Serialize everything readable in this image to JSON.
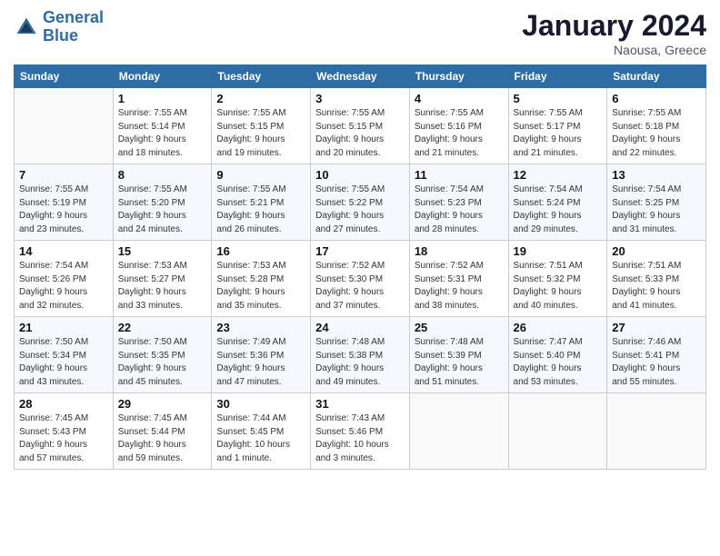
{
  "header": {
    "logo_line1": "General",
    "logo_line2": "Blue",
    "month": "January 2024",
    "location": "Naousa, Greece"
  },
  "days_of_week": [
    "Sunday",
    "Monday",
    "Tuesday",
    "Wednesday",
    "Thursday",
    "Friday",
    "Saturday"
  ],
  "weeks": [
    [
      {
        "day": "",
        "info": ""
      },
      {
        "day": "1",
        "info": "Sunrise: 7:55 AM\nSunset: 5:14 PM\nDaylight: 9 hours\nand 18 minutes."
      },
      {
        "day": "2",
        "info": "Sunrise: 7:55 AM\nSunset: 5:15 PM\nDaylight: 9 hours\nand 19 minutes."
      },
      {
        "day": "3",
        "info": "Sunrise: 7:55 AM\nSunset: 5:15 PM\nDaylight: 9 hours\nand 20 minutes."
      },
      {
        "day": "4",
        "info": "Sunrise: 7:55 AM\nSunset: 5:16 PM\nDaylight: 9 hours\nand 21 minutes."
      },
      {
        "day": "5",
        "info": "Sunrise: 7:55 AM\nSunset: 5:17 PM\nDaylight: 9 hours\nand 21 minutes."
      },
      {
        "day": "6",
        "info": "Sunrise: 7:55 AM\nSunset: 5:18 PM\nDaylight: 9 hours\nand 22 minutes."
      }
    ],
    [
      {
        "day": "7",
        "info": "Sunrise: 7:55 AM\nSunset: 5:19 PM\nDaylight: 9 hours\nand 23 minutes."
      },
      {
        "day": "8",
        "info": "Sunrise: 7:55 AM\nSunset: 5:20 PM\nDaylight: 9 hours\nand 24 minutes."
      },
      {
        "day": "9",
        "info": "Sunrise: 7:55 AM\nSunset: 5:21 PM\nDaylight: 9 hours\nand 26 minutes."
      },
      {
        "day": "10",
        "info": "Sunrise: 7:55 AM\nSunset: 5:22 PM\nDaylight: 9 hours\nand 27 minutes."
      },
      {
        "day": "11",
        "info": "Sunrise: 7:54 AM\nSunset: 5:23 PM\nDaylight: 9 hours\nand 28 minutes."
      },
      {
        "day": "12",
        "info": "Sunrise: 7:54 AM\nSunset: 5:24 PM\nDaylight: 9 hours\nand 29 minutes."
      },
      {
        "day": "13",
        "info": "Sunrise: 7:54 AM\nSunset: 5:25 PM\nDaylight: 9 hours\nand 31 minutes."
      }
    ],
    [
      {
        "day": "14",
        "info": "Sunrise: 7:54 AM\nSunset: 5:26 PM\nDaylight: 9 hours\nand 32 minutes."
      },
      {
        "day": "15",
        "info": "Sunrise: 7:53 AM\nSunset: 5:27 PM\nDaylight: 9 hours\nand 33 minutes."
      },
      {
        "day": "16",
        "info": "Sunrise: 7:53 AM\nSunset: 5:28 PM\nDaylight: 9 hours\nand 35 minutes."
      },
      {
        "day": "17",
        "info": "Sunrise: 7:52 AM\nSunset: 5:30 PM\nDaylight: 9 hours\nand 37 minutes."
      },
      {
        "day": "18",
        "info": "Sunrise: 7:52 AM\nSunset: 5:31 PM\nDaylight: 9 hours\nand 38 minutes."
      },
      {
        "day": "19",
        "info": "Sunrise: 7:51 AM\nSunset: 5:32 PM\nDaylight: 9 hours\nand 40 minutes."
      },
      {
        "day": "20",
        "info": "Sunrise: 7:51 AM\nSunset: 5:33 PM\nDaylight: 9 hours\nand 41 minutes."
      }
    ],
    [
      {
        "day": "21",
        "info": "Sunrise: 7:50 AM\nSunset: 5:34 PM\nDaylight: 9 hours\nand 43 minutes."
      },
      {
        "day": "22",
        "info": "Sunrise: 7:50 AM\nSunset: 5:35 PM\nDaylight: 9 hours\nand 45 minutes."
      },
      {
        "day": "23",
        "info": "Sunrise: 7:49 AM\nSunset: 5:36 PM\nDaylight: 9 hours\nand 47 minutes."
      },
      {
        "day": "24",
        "info": "Sunrise: 7:48 AM\nSunset: 5:38 PM\nDaylight: 9 hours\nand 49 minutes."
      },
      {
        "day": "25",
        "info": "Sunrise: 7:48 AM\nSunset: 5:39 PM\nDaylight: 9 hours\nand 51 minutes."
      },
      {
        "day": "26",
        "info": "Sunrise: 7:47 AM\nSunset: 5:40 PM\nDaylight: 9 hours\nand 53 minutes."
      },
      {
        "day": "27",
        "info": "Sunrise: 7:46 AM\nSunset: 5:41 PM\nDaylight: 9 hours\nand 55 minutes."
      }
    ],
    [
      {
        "day": "28",
        "info": "Sunrise: 7:45 AM\nSunset: 5:43 PM\nDaylight: 9 hours\nand 57 minutes."
      },
      {
        "day": "29",
        "info": "Sunrise: 7:45 AM\nSunset: 5:44 PM\nDaylight: 9 hours\nand 59 minutes."
      },
      {
        "day": "30",
        "info": "Sunrise: 7:44 AM\nSunset: 5:45 PM\nDaylight: 10 hours\nand 1 minute."
      },
      {
        "day": "31",
        "info": "Sunrise: 7:43 AM\nSunset: 5:46 PM\nDaylight: 10 hours\nand 3 minutes."
      },
      {
        "day": "",
        "info": ""
      },
      {
        "day": "",
        "info": ""
      },
      {
        "day": "",
        "info": ""
      }
    ]
  ]
}
